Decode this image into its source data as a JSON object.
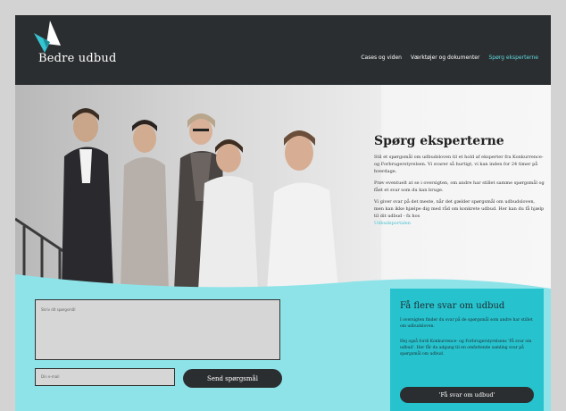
{
  "header": {
    "logo_text": "Bedre udbud",
    "nav": [
      {
        "label": "Cases og viden"
      },
      {
        "label": "Værktøjer og dokumenter"
      },
      {
        "label": "Spørg eksperterne"
      }
    ]
  },
  "hero": {
    "title": "Spørg eksperterne",
    "p1": "Stil et spørgsmål om udbudsloven til et hold af eksperter fra Konkurrence- og Forbrugerstyrelsen. Vi svarer så hurtigt, vi kan inden for 24 timer på hverdage.",
    "p2": "Prøv eventuelt at se i oversigten, om andre har stillet samme spørgsmål og fået et svar som du kan bruge.",
    "p3": "Vi giver svar på det meste, når det gælder spørgsmål om udbudsloven, men kan ikke hjælpe dig med råd om konkrete udbud. Her kan du få hjælp til dit udbud - fx hos",
    "p3_link": "Udbudsportalen"
  },
  "form": {
    "question_placeholder": "Skriv dit spørgsmål",
    "email_placeholder": "Din e-mail",
    "send_label": "Send spørgsmål"
  },
  "side": {
    "title": "Få flere svar om udbud",
    "p1": "I oversigten finder du svar på de spørgsmål som andre har stillet om udbudsloven.",
    "p2": "Hej også fordi Konkurrence- og Forbrugerstyrelsens 'Få svar om udbud'. Her får du adgang til en omfattende samling svar på spørgsmål om udbud.",
    "button_label": "'Få svar om udbud'"
  },
  "colors": {
    "header_bg": "#2b2e30",
    "accent": "#5fd7e0",
    "turquoise": "#8ee3e8",
    "card": "#26c3cf"
  }
}
